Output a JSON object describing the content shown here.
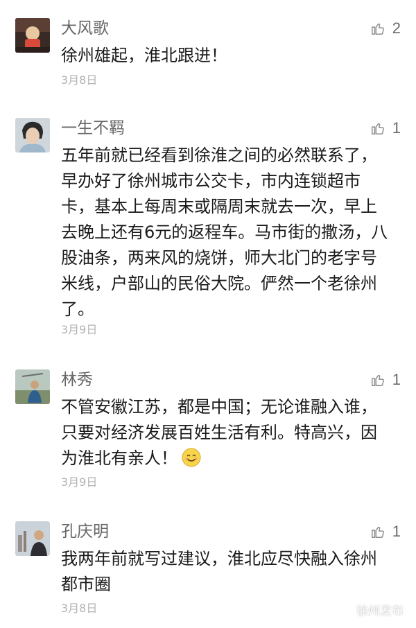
{
  "colors": {
    "nickname": "#666666",
    "text": "#1a1a1a",
    "date": "#b2b2b2",
    "like_icon": "#8c8c8c"
  },
  "comments": [
    {
      "nickname": "大风歌",
      "likes": "2",
      "like_icon": "thumbs-up-icon",
      "lines": [
        "徐州雄起，淮北跟进！"
      ],
      "date": "3月8日"
    },
    {
      "nickname": "一生不羁",
      "likes": "1",
      "like_icon": "thumbs-up-icon",
      "lines": [
        "五年前就已经看到徐淮之间的必然联系了，",
        "早办好了徐州城市公交卡，市内连锁超市",
        "卡，基本上每周末或隔周末就去一次，早上",
        "去晚上还有6元的返程车。马市街的撒汤，八",
        "股油条，两来风的烧饼，师大北门的老字号",
        "米线，户部山的民俗大院。俨然一个老徐州",
        "了。"
      ],
      "date": "3月9日"
    },
    {
      "nickname": "林秀",
      "likes": "1",
      "like_icon": "thumbs-up-icon",
      "lines": [
        "不管安徽江苏，都是中国；无论谁融入谁，",
        "只要对经济发展百姓生活有利。特高兴，因",
        "为淮北有亲人！"
      ],
      "emoji": "smile-emoji-icon",
      "date": "3月9日"
    },
    {
      "nickname": "孔庆明",
      "likes": "1",
      "like_icon": "thumbs-up-icon",
      "lines": [
        "我两年前就写过建议，淮北应尽快融入徐州",
        "都市圈"
      ],
      "date": "3月8日"
    }
  ],
  "watermark": {
    "icon": "wechat-icon",
    "text": "徐州发布"
  }
}
